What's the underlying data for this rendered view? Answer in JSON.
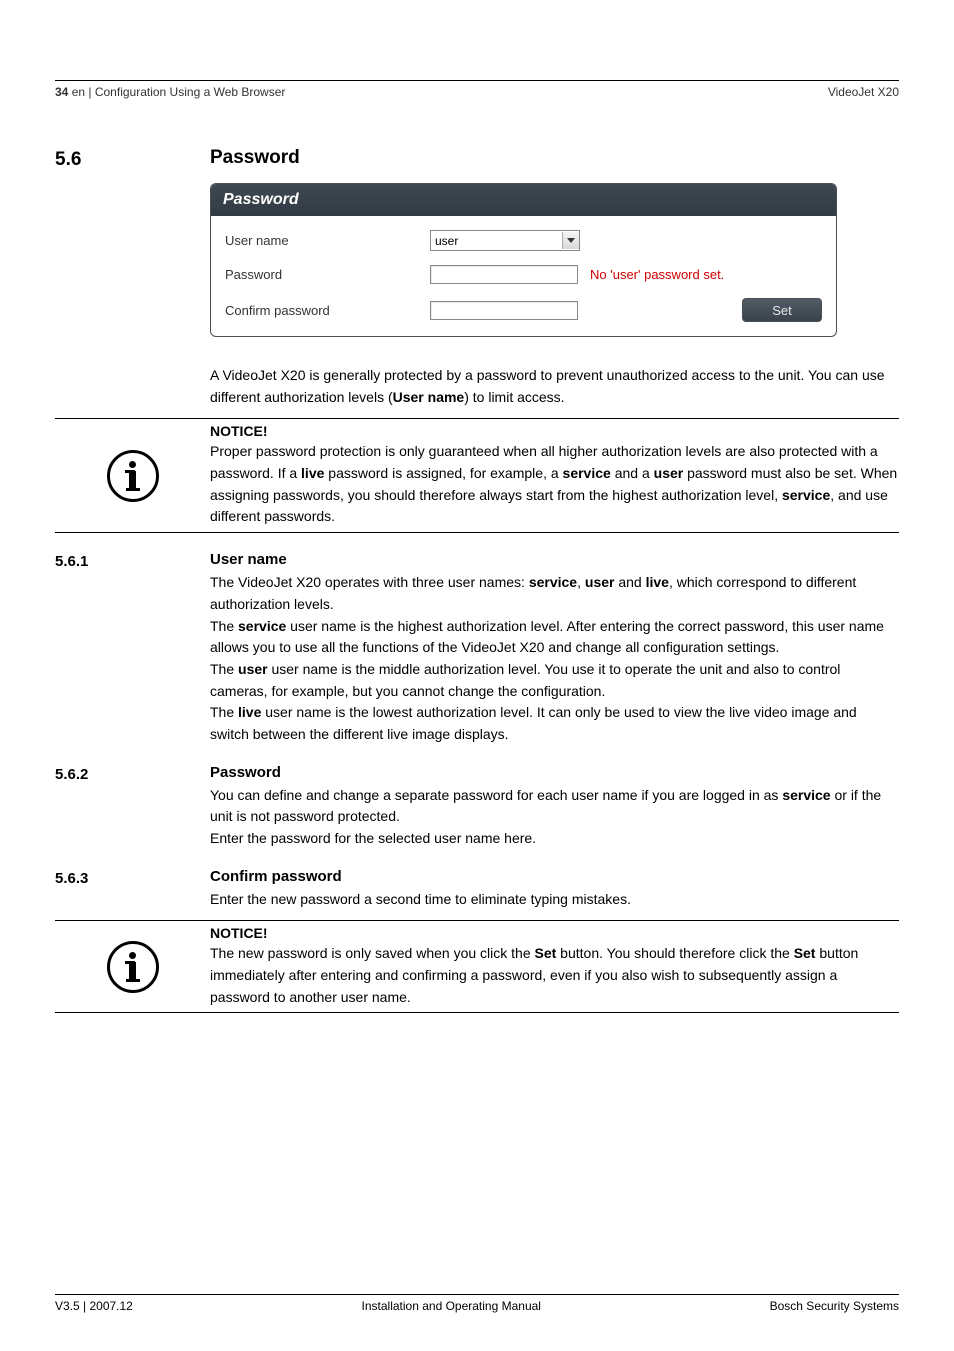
{
  "header": {
    "page_number": "34",
    "breadcrumb_prefix": "en | ",
    "breadcrumb": "Configuration Using a Web Browser",
    "product": "VideoJet X20"
  },
  "section56": {
    "num": "5.6",
    "title": "Password"
  },
  "panel": {
    "title": "Password",
    "rows": {
      "username": {
        "label": "User name",
        "value": "user"
      },
      "password": {
        "label": "Password",
        "status": "No 'user' password set."
      },
      "confirm": {
        "label": "Confirm password",
        "button": "Set"
      }
    }
  },
  "intro": {
    "part1": "A VideoJet X20 is generally protected by a password to prevent unauthorized access to the unit. You can use different authorization levels (",
    "bold": "User name",
    "part2": ") to limit access."
  },
  "notice1": {
    "title": "NOTICE!",
    "line1_a": "Proper password protection is only guaranteed when all higher authorization levels are also protected with a password. If a ",
    "live": "live",
    "line1_b": " password is assigned, for example, a ",
    "service": "service",
    "line1_c": " and a ",
    "user": "user",
    "line1_d": " password must also be set. When assigning passwords, you should therefore always start from the highest authorization level, ",
    "service2": "service",
    "line1_e": ", and use different passwords."
  },
  "sec561": {
    "num": "5.6.1",
    "title": "User name",
    "p1a": "The VideoJet X20 operates with three user names: ",
    "b1": "service",
    "comma1": ", ",
    "b2": "user",
    "and": " and ",
    "b3": "live",
    "p1b": ", which correspond to different authorization levels.",
    "p2a": "The ",
    "p2b": "service",
    "p2c": " user name is the highest authorization level. After entering the correct password, this user name allows you to use all the functions of the VideoJet X20 and change all configuration settings.",
    "p3a": "The ",
    "p3b": "user",
    "p3c": " user name is the middle authorization level. You use it to operate the unit and also to control cameras, for example, but you cannot change the configuration.",
    "p4a": "The ",
    "p4b": "live",
    "p4c": " user name is the lowest authorization level. It can only be used to view the live video image and switch between the different live image displays."
  },
  "sec562": {
    "num": "5.6.2",
    "title": "Password",
    "p1a": "You can define and change a separate password for each user name if you are logged in as ",
    "b1": "service",
    "p1b": " or if the unit is not password protected.",
    "p2": "Enter the password for the selected user name here."
  },
  "sec563": {
    "num": "5.6.3",
    "title": "Confirm password",
    "p1": "Enter the new password a second time to eliminate typing mistakes."
  },
  "notice2": {
    "title": "NOTICE!",
    "p1a": "The new password is only saved when you click the ",
    "b1": "Set",
    "p1b": " button. You should therefore click the ",
    "b2": "Set",
    "p1c": " button immediately after entering and confirming a password, even if you also wish to subsequently assign a password to another user name."
  },
  "footer": {
    "left": "V3.5 | 2007.12",
    "center": "Installation and Operating Manual",
    "right": "Bosch Security Systems"
  }
}
